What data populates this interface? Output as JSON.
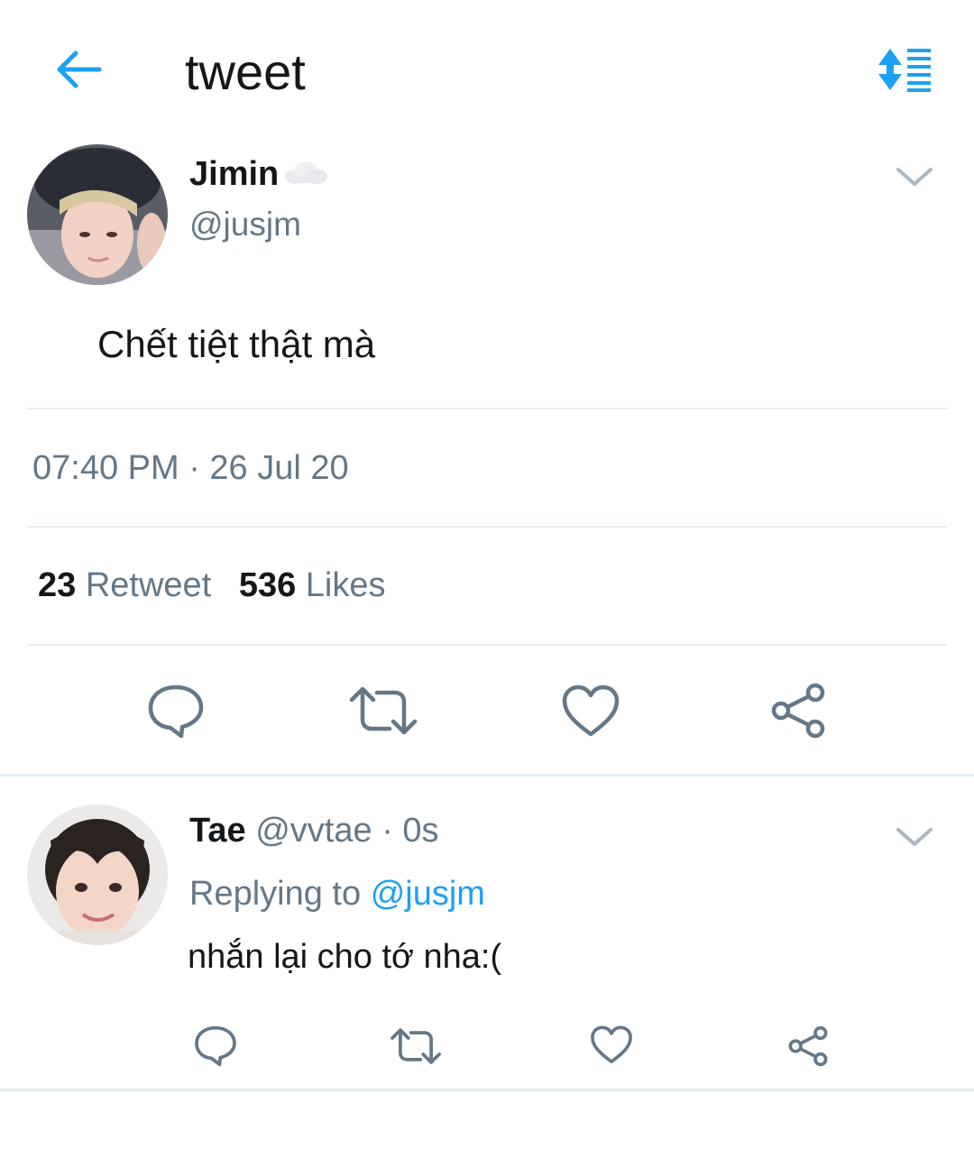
{
  "header": {
    "title": "tweet",
    "back_icon": "arrow-left-icon",
    "sort_icon": "sort-icon",
    "accent": "#1da1f2"
  },
  "tweet": {
    "display_name": "Jimin",
    "name_emoji": "cloud-icon",
    "handle": "@jusjm",
    "text": "Chết tiệt thật mà",
    "timestamp": "07:40 PM · 26 Jul 20",
    "retweets_count": "23",
    "retweets_label": "Retweet",
    "likes_count": "536",
    "likes_label": "Likes",
    "actions": [
      "reply-icon",
      "retweet-icon",
      "like-icon",
      "share-icon"
    ]
  },
  "reply": {
    "display_name": "Tae",
    "handle": "@vvtae",
    "time": "· 0s",
    "replying_to_label": "Replying to",
    "replying_to_handle": "@jusjm",
    "text": "nhắn lại cho tớ nha:(",
    "actions": [
      "reply-icon",
      "retweet-icon",
      "like-icon",
      "share-icon"
    ]
  }
}
